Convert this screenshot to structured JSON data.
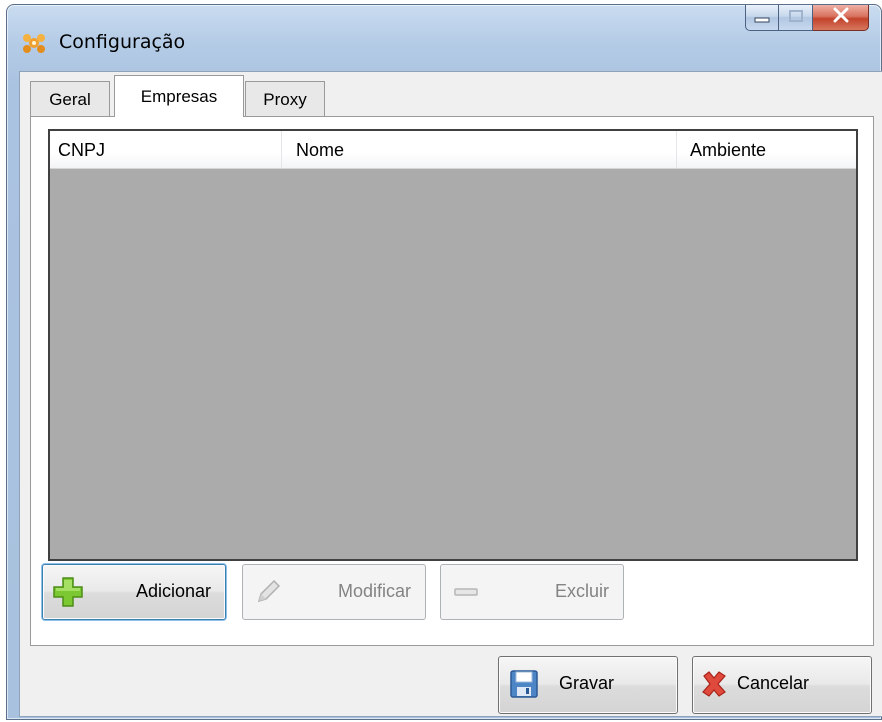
{
  "window": {
    "title": "Configuração",
    "icon": "app-gears-icon",
    "caption_buttons": [
      "minimize-icon",
      "maximize-icon",
      "close-icon"
    ]
  },
  "tabs": [
    {
      "label": "Geral",
      "selected": false
    },
    {
      "label": "Empresas",
      "selected": true
    },
    {
      "label": "Proxy",
      "selected": false
    }
  ],
  "listview": {
    "columns": [
      "CNPJ",
      "Nome",
      "Ambiente"
    ],
    "rows": []
  },
  "list_buttons": {
    "add_label": "Adicionar",
    "modify_label": "Modificar",
    "delete_label": "Excluir"
  },
  "footer_buttons": {
    "save_label": "Gravar",
    "cancel_label": "Cancelar"
  },
  "colors": {
    "list_background": "#ababab",
    "add_icon": "#6fbd2a",
    "cancel_icon": "#d9302b",
    "app_icon": "#f0a030"
  }
}
